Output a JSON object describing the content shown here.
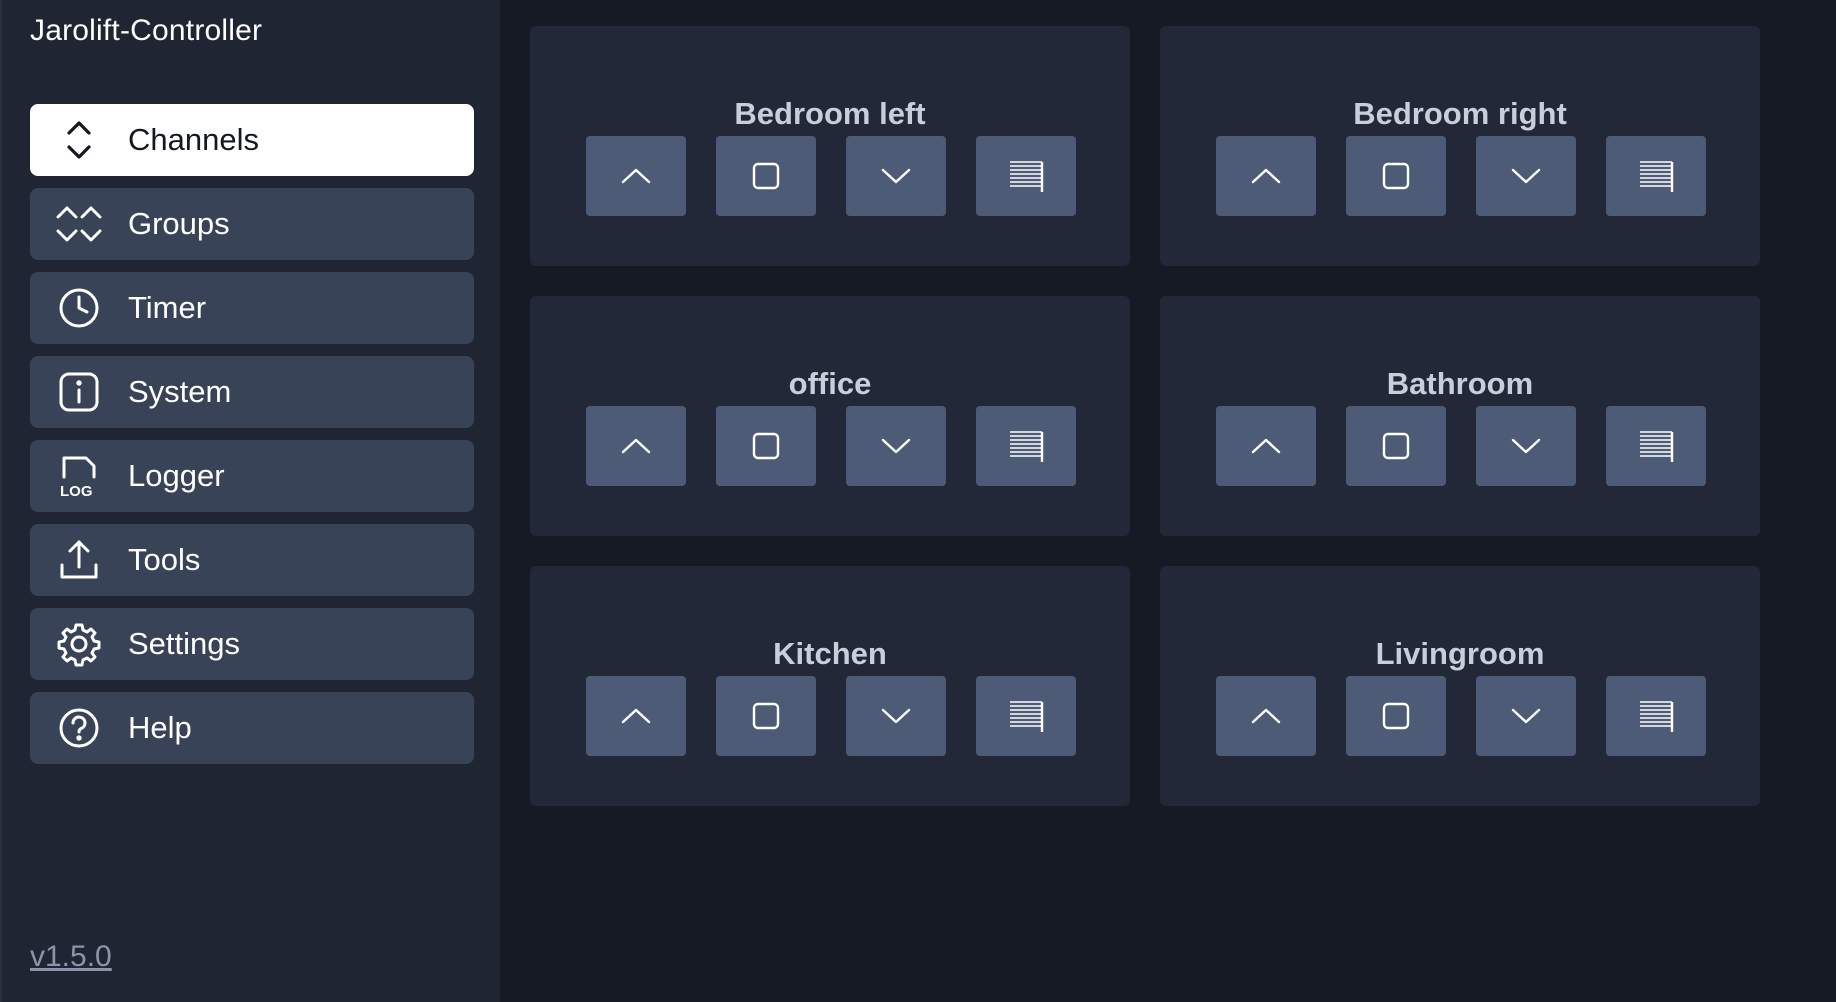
{
  "sidebar": {
    "app_title": "Jarolift-Controller",
    "items": [
      {
        "label": "Channels",
        "icon": "chevrons-up-down-icon",
        "active": true
      },
      {
        "label": "Groups",
        "icon": "double-chevrons-icon",
        "active": false
      },
      {
        "label": "Timer",
        "icon": "clock-icon",
        "active": false
      },
      {
        "label": "System",
        "icon": "info-icon",
        "active": false
      },
      {
        "label": "Logger",
        "icon": "log-icon",
        "active": false
      },
      {
        "label": "Tools",
        "icon": "upload-icon",
        "active": false
      },
      {
        "label": "Settings",
        "icon": "gear-icon",
        "active": false
      },
      {
        "label": "Help",
        "icon": "help-icon",
        "active": false
      }
    ],
    "version": "v1.5.0"
  },
  "channels": [
    {
      "name": "Bedroom left"
    },
    {
      "name": "Bedroom right"
    },
    {
      "name": "office"
    },
    {
      "name": "Bathroom"
    },
    {
      "name": "Kitchen"
    },
    {
      "name": "Livingroom"
    }
  ],
  "controls": [
    {
      "icon": "chevron-up-icon",
      "action": "up"
    },
    {
      "icon": "stop-square-icon",
      "action": "stop"
    },
    {
      "icon": "chevron-down-icon",
      "action": "down"
    },
    {
      "icon": "shade-icon",
      "action": "shade"
    }
  ],
  "colors": {
    "background": "#151a24",
    "sidebar": "#1f2532",
    "nav_item": "#394357",
    "nav_active": "#ffffff",
    "card": "#222837",
    "button": "#4e5b76",
    "card_title": "#c9cfda",
    "version_link": "#8a94aa"
  }
}
